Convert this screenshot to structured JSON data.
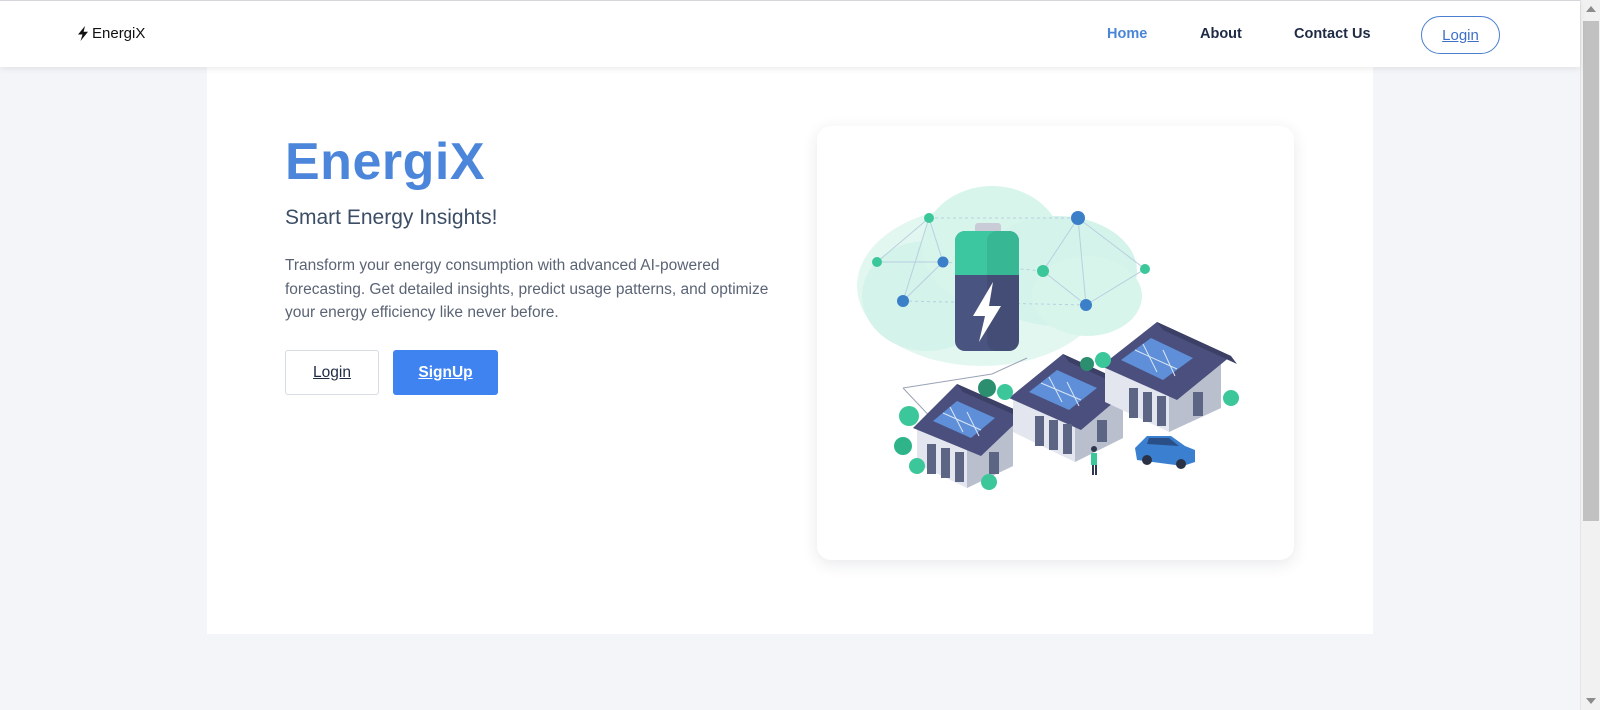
{
  "navbar": {
    "brand": "EnergiX",
    "brand_icon": "lightning-bolt-icon",
    "links": [
      {
        "label": "Home",
        "active": true
      },
      {
        "label": "About",
        "active": false
      },
      {
        "label": "Contact Us",
        "active": false
      }
    ],
    "login_label": "Login"
  },
  "hero": {
    "title": "EnergiX",
    "subtitle": "Smart Energy Insights!",
    "description": "Transform your energy consumption with advanced AI-powered forecasting. Get detailed insights, predict usage patterns, and optimize your energy efficiency like never before.",
    "login_label": "Login",
    "signup_label": "SignUp"
  },
  "illustration": {
    "icon": "smart-energy-houses-illustration"
  },
  "colors": {
    "accent": "#4b86db",
    "primary_button": "#3f83f0",
    "page_background": "#f3f5f9",
    "battery_green": "#3cc7a0",
    "battery_body": "#4a5480",
    "roof": "#4b4f7d"
  }
}
